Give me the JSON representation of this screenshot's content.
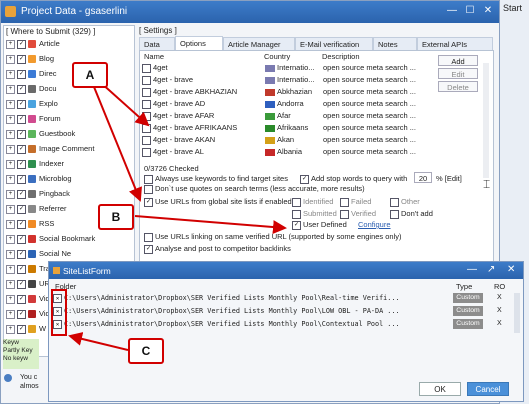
{
  "window": {
    "title": "Project Data - gsaserlini",
    "start_label": "Start"
  },
  "left_panel": {
    "header": "[ Where to Submit  (329) ]",
    "items": [
      {
        "label": "Article",
        "checked": true
      },
      {
        "label": "Blog",
        "checked": true
      },
      {
        "label": "Direc",
        "checked": true
      },
      {
        "label": "Docu",
        "checked": true
      },
      {
        "label": "Explo",
        "checked": true
      },
      {
        "label": "Forum",
        "checked": true
      },
      {
        "label": "Guestbook",
        "checked": true
      },
      {
        "label": "Image Comment",
        "checked": true
      },
      {
        "label": "Indexer",
        "checked": true
      },
      {
        "label": "Microblog",
        "checked": true
      },
      {
        "label": "Pingback",
        "checked": true
      },
      {
        "label": "Referrer",
        "checked": true
      },
      {
        "label": "RSS",
        "checked": true
      },
      {
        "label": "Social Bookmark",
        "checked": true
      },
      {
        "label": "Social Ne",
        "checked": true
      },
      {
        "label": "Trackbac",
        "checked": true
      },
      {
        "label": "URL Shor",
        "checked": true
      },
      {
        "label": "Video",
        "checked": true
      },
      {
        "label": "Video-Adult",
        "checked": true
      },
      {
        "label": "W",
        "checked": true
      }
    ],
    "keyword_box": [
      "Keyw",
      "Partly Key",
      "No keyw"
    ],
    "footer_text": [
      "You c",
      "almos"
    ]
  },
  "settings": {
    "header": "[ Settings ]",
    "tabs": [
      "Data",
      "Options",
      "Article Manager",
      "E-Mail verification",
      "Notes",
      "External APIs"
    ],
    "columns": [
      "Name",
      "Country",
      "Description"
    ],
    "engines": [
      {
        "name": "4get",
        "country": "Internatio...",
        "desc": "open source meta search ..."
      },
      {
        "name": "4get - brave",
        "country": "Internatio...",
        "desc": "open source meta search ..."
      },
      {
        "name": "4get - brave ABKHAZIAN",
        "country": "Abkhazian",
        "desc": "open source meta search ..."
      },
      {
        "name": "4get - brave AD",
        "country": "Andorra",
        "desc": "open source meta search ..."
      },
      {
        "name": "4get - brave AFAR",
        "country": "Afar",
        "desc": "open source meta search ..."
      },
      {
        "name": "4get - brave AFRIKAANS",
        "country": "Afrikaans",
        "desc": "open source meta search ..."
      },
      {
        "name": "4get - brave AKAN",
        "country": "Akan",
        "desc": "open source meta search ..."
      },
      {
        "name": "4get - brave AL",
        "country": "Albania",
        "desc": "open source meta search ..."
      }
    ],
    "side_buttons": [
      "Add",
      "Edit",
      "Delete"
    ],
    "checked_count": "0/3726 Checked",
    "opt_keywords": "Always use keywords to find target sites",
    "opt_quotes": "Don`t use quotes on search terms (less accurate, more results)",
    "opt_stopwords": "Add stop words to query with",
    "stopwords_value": "20",
    "edit_link": "% [Edit]",
    "opt_global": "Use URLs from global site lists if enabled",
    "global_opts": [
      "Identified",
      "Failed",
      "Other",
      "Submitted",
      "Verified"
    ],
    "dont_add": "Don't add",
    "user_defined": "User Defined",
    "configure": "Configure",
    "opt_linking": "Use URLs linking on same verified URL (supported by some engines only)",
    "opt_analyse": "Analyse and post to competitor backlinks"
  },
  "sitelist_form": {
    "title": "SiteListForm",
    "col_folder": "Folder",
    "col_type": "Type",
    "col_ro": "RO",
    "rows": [
      {
        "path": "C:\\Users\\Administrator\\Dropbox\\SER Verified Lists Monthly Pool\\Real-time Verifi...",
        "type": "Custom",
        "ro": "X"
      },
      {
        "path": "C:\\Users\\Administrator\\Dropbox\\SER Verified Lists Monthly Pool\\LOW OBL - PA-DA ...",
        "type": "Custom",
        "ro": "X"
      },
      {
        "path": "C:\\Users\\Administrator\\Dropbox\\SER Verified Lists Monthly Pool\\Contextual Pool ...",
        "type": "Custom",
        "ro": "X"
      }
    ],
    "ok_label": "OK",
    "cancel_label": "Cancel"
  },
  "annotations": {
    "a": "A",
    "b": "B",
    "c": "C"
  },
  "colors": {
    "titlebar": "#2b63ad",
    "annotation": "#d10000",
    "cancel": "#4a90d9"
  }
}
